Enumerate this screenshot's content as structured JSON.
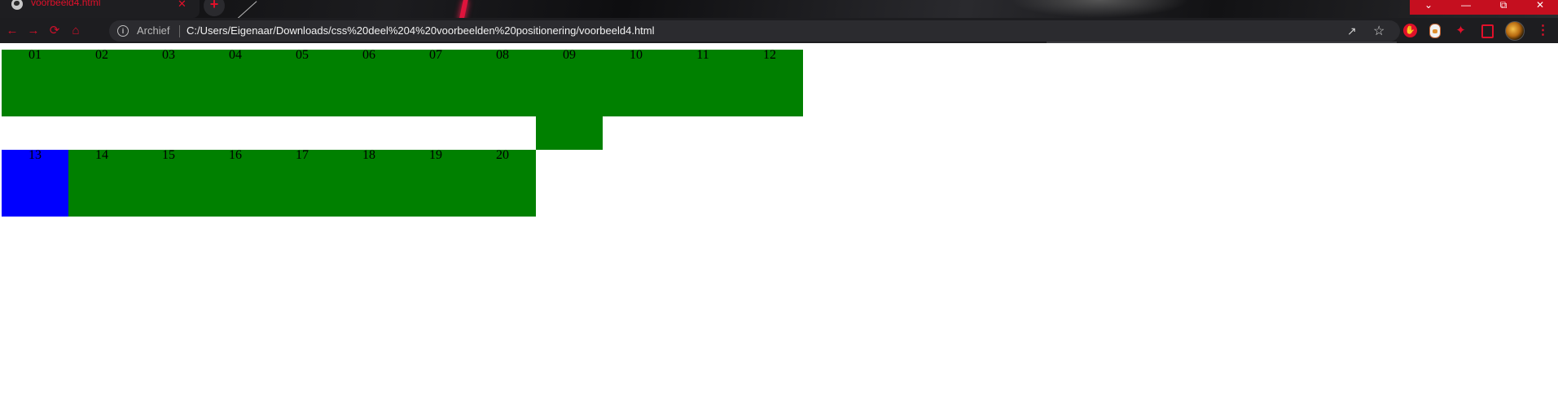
{
  "browser": {
    "tab": {
      "title": "voorbeeld4.html",
      "close_glyph": "✕",
      "favicon": "globe-icon"
    },
    "new_tab_glyph": "+",
    "window_controls": [
      "chevron-down-icon",
      "minimize-icon",
      "restore-icon",
      "close-icon"
    ],
    "nav": {
      "back": "arrow-left-icon",
      "forward": "arrow-right-icon",
      "reload": "reload-icon",
      "home": "home-icon"
    },
    "address": {
      "security_label": "Archief",
      "url": "C:/Users/Eigenaar/Downloads/css%20deel%204%20voorbeelden%20positionering/voorbeeld4.html"
    },
    "accent_color": "#e0102a"
  },
  "page": {
    "background": "#ffffff",
    "box_color": "#008000",
    "highlight_color": "#0000ff",
    "boxes": [
      {
        "label": "01",
        "highlight": false
      },
      {
        "label": "02",
        "highlight": false
      },
      {
        "label": "03",
        "highlight": false
      },
      {
        "label": "04",
        "highlight": false
      },
      {
        "label": "05",
        "highlight": false
      },
      {
        "label": "06",
        "highlight": false
      },
      {
        "label": "07",
        "highlight": false
      },
      {
        "label": "08",
        "highlight": false
      },
      {
        "label": "09",
        "highlight": false
      },
      {
        "label": "10",
        "highlight": false
      },
      {
        "label": "11",
        "highlight": false
      },
      {
        "label": "12",
        "highlight": false
      },
      {
        "label": "13",
        "highlight": true
      },
      {
        "label": "14",
        "highlight": false
      },
      {
        "label": "15",
        "highlight": false
      },
      {
        "label": "16",
        "highlight": false
      },
      {
        "label": "17",
        "highlight": false
      },
      {
        "label": "18",
        "highlight": false
      },
      {
        "label": "19",
        "highlight": false
      },
      {
        "label": "20",
        "highlight": false
      }
    ]
  }
}
